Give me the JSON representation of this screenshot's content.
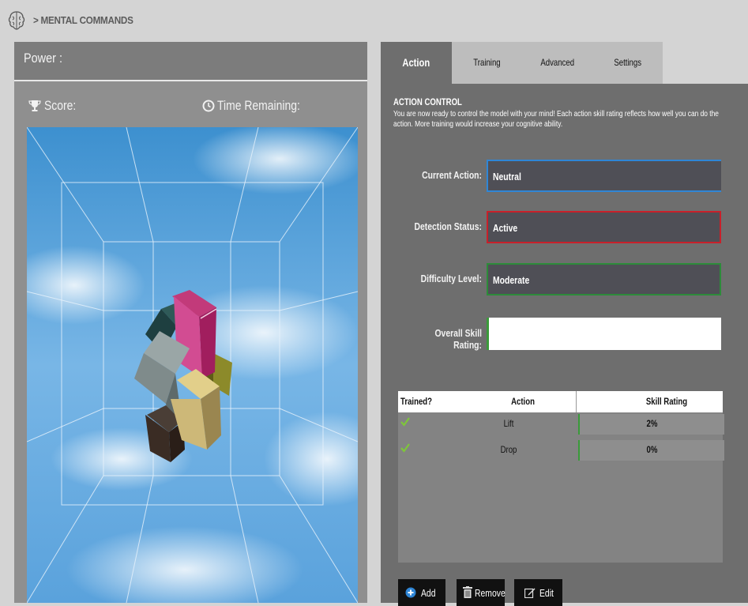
{
  "header": {
    "breadcrumb": "> MENTAL COMMANDS"
  },
  "game": {
    "power_label": "Power :",
    "score_label": "Score:",
    "time_label": "Time Remaining:"
  },
  "tabs": [
    {
      "label": "Action",
      "active": true
    },
    {
      "label": "Training",
      "active": false
    },
    {
      "label": "Advanced",
      "active": false
    },
    {
      "label": "Settings",
      "active": false
    }
  ],
  "action_control": {
    "title": "ACTION CONTROL",
    "description": "You are now ready to control the model with your mind! Each action skill rating reflects how well you can do the action. More training would increase your cognitive ability.",
    "current_action": {
      "label": "Current Action:",
      "value": "Neutral",
      "border_color": "#2f86d6"
    },
    "detection_status": {
      "label": "Detection Status:",
      "value": "Active",
      "border_color": "#c8202a"
    },
    "difficulty_level": {
      "label": "Difficulty Level:",
      "value": "Moderate",
      "border_color": "#2d8b3a"
    },
    "overall_skill": {
      "label": "Overall Skill Rating:",
      "fraction": 0.01
    }
  },
  "table": {
    "headers": {
      "trained": "Trained?",
      "action": "Action",
      "skill": "Skill Rating"
    },
    "rows": [
      {
        "trained": true,
        "action": "Lift",
        "skill": "2%"
      },
      {
        "trained": true,
        "action": "Drop",
        "skill": "0%"
      }
    ]
  },
  "buttons": {
    "add": "Add",
    "remove": "Remove",
    "edit": "Edit"
  },
  "colors": {
    "accent_green": "#3a9a3a",
    "check_green": "#7ec63a",
    "add_icon_blue": "#2f86d6"
  }
}
